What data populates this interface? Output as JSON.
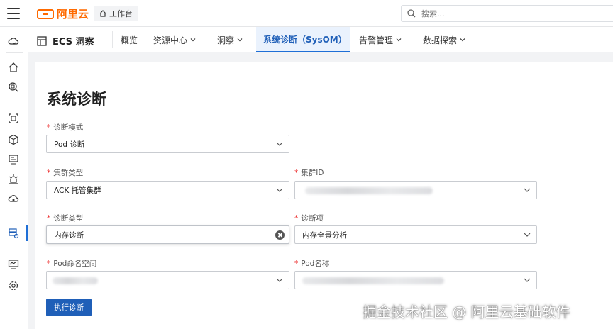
{
  "topbar": {
    "brand": "阿里云",
    "workbench": "工作台",
    "search_placeholder": "搜索..."
  },
  "product": {
    "title": "ECS 洞察",
    "tabs": [
      {
        "label": "概览",
        "active": false,
        "dropdown": false
      },
      {
        "label": "资源中心",
        "active": false,
        "dropdown": true
      },
      {
        "label": "洞察",
        "active": false,
        "dropdown": true
      },
      {
        "label": "系统诊断（SysOM）",
        "active": true,
        "dropdown": false
      },
      {
        "label": "告警管理",
        "active": false,
        "dropdown": true
      },
      {
        "label": "数据探索",
        "active": false,
        "dropdown": true
      }
    ]
  },
  "page": {
    "title": "系统诊断"
  },
  "form": {
    "diag_mode": {
      "label": "诊断模式",
      "value": "Pod 诊断"
    },
    "cluster_type": {
      "label": "集群类型",
      "value": "ACK 托管集群"
    },
    "cluster_id": {
      "label": "集群ID",
      "value": ""
    },
    "diag_type": {
      "label": "诊断类型",
      "value": "内存诊断"
    },
    "diag_item": {
      "label": "诊断项",
      "value": "内存全景分析"
    },
    "pod_namespace": {
      "label": "Pod命名空间",
      "value": ""
    },
    "pod_name": {
      "label": "Pod名称",
      "value": ""
    },
    "submit_label": "执行诊断"
  },
  "watermark": "掘金技术社区 @ 阿里云基础软件",
  "colors": {
    "brand": "#ff6a00",
    "primary": "#1f5fb8",
    "required": "#e33333"
  }
}
